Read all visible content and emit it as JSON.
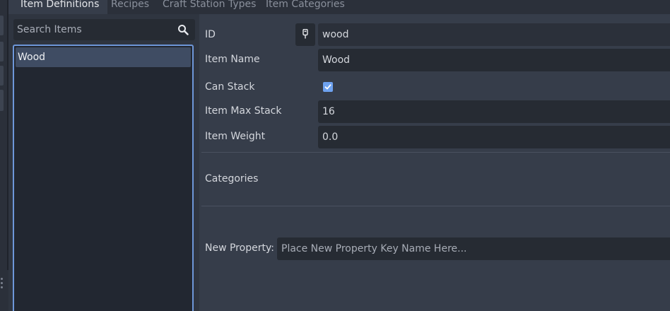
{
  "tabs": [
    {
      "label": "Item Definitions",
      "active": true
    },
    {
      "label": "Recipes",
      "active": false
    },
    {
      "label": "Craft Station Types",
      "active": false
    },
    {
      "label": "Item Categories",
      "active": false
    }
  ],
  "search": {
    "placeholder": "Search Items",
    "value": "",
    "icon": "search-icon"
  },
  "items": [
    {
      "label": "Wood",
      "selected": true
    }
  ],
  "form": {
    "id_label": "ID",
    "id_value": "wood",
    "id_icon": "pin-icon",
    "name_label": "Item Name",
    "name_value": "Wood",
    "can_stack_label": "Can Stack",
    "can_stack_checked": true,
    "max_stack_label": "Item Max Stack",
    "max_stack_value": "16",
    "weight_label": "Item Weight",
    "weight_value": "0.0",
    "categories_label": "Categories",
    "new_property_label": "New Property:",
    "new_property_placeholder": "Place New Property Key Name Here...",
    "new_property_value": ""
  },
  "colors": {
    "accent": "#6ea2f0",
    "panel_bg": "#363d4a",
    "input_bg": "#262b33",
    "list_bg": "#222731",
    "selection": "#3f4c63",
    "list_border": "#6e97d9"
  }
}
